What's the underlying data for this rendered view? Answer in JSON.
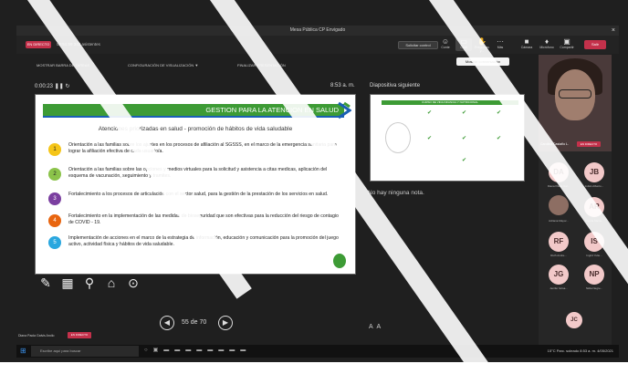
{
  "window": {
    "title": "Mesa Pública CP Envigado",
    "close_icon": "close-icon"
  },
  "meeting_bar": {
    "live_badge": "EN DIRECTO",
    "elapsed": "02:51:59",
    "participants_text": "343 asistentes",
    "control_button": "Solicitar control",
    "tooltip": "Mostrar conversación",
    "leave_label": "Salir",
    "tools": [
      {
        "icon": "people-icon",
        "label": "Conte"
      },
      {
        "icon": "chat-icon",
        "label": "Chat"
      },
      {
        "icon": "raise-hand-icon",
        "label": "Preguntas y..."
      },
      {
        "icon": "more-icon",
        "label": "Más"
      }
    ],
    "right_tools": [
      {
        "icon": "camera-icon",
        "label": "Cámara"
      },
      {
        "icon": "mic-icon",
        "label": "Micrófono"
      },
      {
        "icon": "share-icon",
        "label": "Compartir"
      }
    ]
  },
  "presenter_toolbar": {
    "show_taskbar": "MOSTRAR BARRA DE TAREAS",
    "display_settings": "CONFIGURACIÓN DE VISUALIZACIÓN ▼",
    "end_presentation": "FINALIZAR PRESENTACIÓN"
  },
  "presentation": {
    "elapsed": "0:00:23",
    "clock": "8:53 a. m.",
    "next_label": "Diapositiva siguiente",
    "notes": "No hay ninguna nota.",
    "page": "55 de 70"
  },
  "slide": {
    "header": "GESTION PARA LA ATENCION EN SALUD",
    "subtitle": "Atenciones priorizadas en salud - promoción de  hábitos de vida saludable",
    "items": [
      {
        "num": "1",
        "color": "#f5c518",
        "text": "Orientación a las familias sobre los ajustes en los procesos de afiliación al SGSSS, en el marco de la  emergencia sanitaria para lograr la afiliación efectiva de cada usuario/a."
      },
      {
        "num": "2",
        "color": "#8bc34a",
        "text": "Orientación a las familias sobre las opciones y medios virtuales para la solicitud y asistencia a citas medicas,  aplicación del esquema de vacunación, seguimiento y tramites."
      },
      {
        "num": "3",
        "color": "#7b3fa0",
        "text": "Fortalecimiento a los procesos de articulación con el sector salud, para la gestión de la prestación de  los servicios en salud."
      },
      {
        "num": "4",
        "color": "#e8650f",
        "text": "Fortalecimiento en la implementación de las medidas de bioseguridad que son  efectivas para la reducción del riesgo de contagio de COVID - 19."
      },
      {
        "num": "5",
        "color": "#2aa7df",
        "text": "Implementación de acciones en el marco de la estrategia de información, educación y comunicación para la promoción del juego activo, actividad  física y hábitos de vida saludable."
      }
    ]
  },
  "next_slide": {
    "title": "CURSO DE VIDA INFANCIA Y NUTRICIONAL"
  },
  "participants": {
    "video_name": "Carolina Castaño L.",
    "video_live": "EN DIRECTO",
    "people": [
      {
        "initials": "DA",
        "name": "Diana Paola Gal..."
      },
      {
        "initials": "JB",
        "name": "Julián Alberto..."
      },
      {
        "initials": "",
        "name": "Adriana Mayor..."
      },
      {
        "initials": "AR",
        "name": "Angela María..."
      },
      {
        "initials": "RF",
        "name": "Ruth Andre..."
      },
      {
        "initials": "IS",
        "name": "Ingrid Yulie..."
      },
      {
        "initials": "JG",
        "name": "Jenifer Grisa..."
      },
      {
        "initials": "NP",
        "name": "Nidia Negre..."
      },
      {
        "initials": "JC",
        "name": ""
      }
    ]
  },
  "bottom": {
    "presenter_name": "Diana Paola Galvis Aroilo",
    "live": "EN DIRECTO"
  },
  "taskbar": {
    "search_placeholder": "Escribe aquí para buscar",
    "weather": "15°C  Parc. soleado",
    "time": "8:53 a. m.",
    "date": "4/05/2021"
  }
}
